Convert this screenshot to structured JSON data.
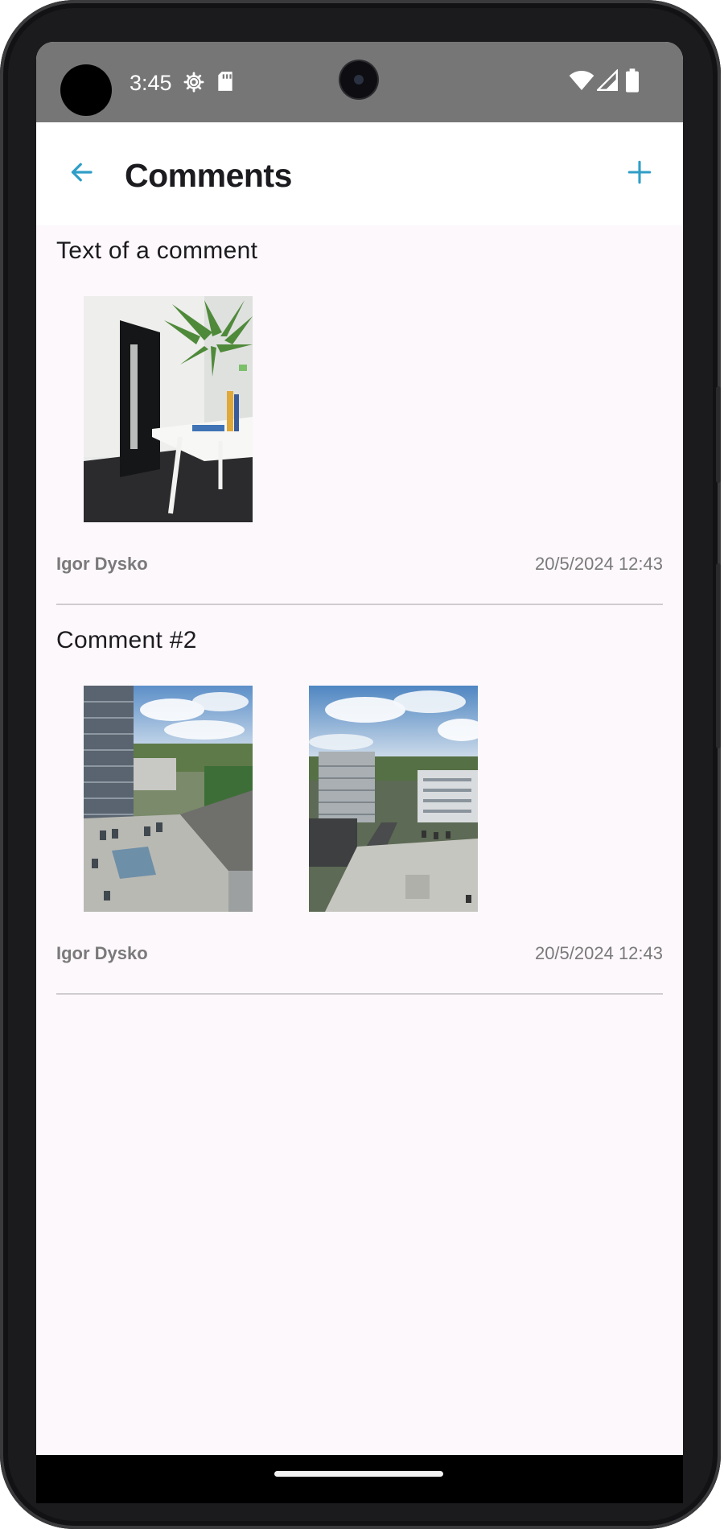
{
  "status_bar": {
    "time": "3:45",
    "icons": [
      "settings-icon",
      "sd-card-icon",
      "wifi-icon",
      "signal-icon",
      "battery-icon"
    ]
  },
  "app_bar": {
    "title": "Comments",
    "back_icon": "arrow-left-icon",
    "add_icon": "plus-icon",
    "accent_color": "#2f9ec7"
  },
  "comments": [
    {
      "text": "Text of a comment",
      "author": "Igor Dysko",
      "date": "20/5/2024 12:43",
      "photos": [
        "office interior with black door, white desk and palm plant"
      ]
    },
    {
      "text": "Comment #2",
      "author": "Igor Dysko",
      "date": "20/5/2024 12:43",
      "photos": [
        "aerial view of parking lot and office tower",
        "aerial view of rooftops and city buildings"
      ]
    }
  ]
}
